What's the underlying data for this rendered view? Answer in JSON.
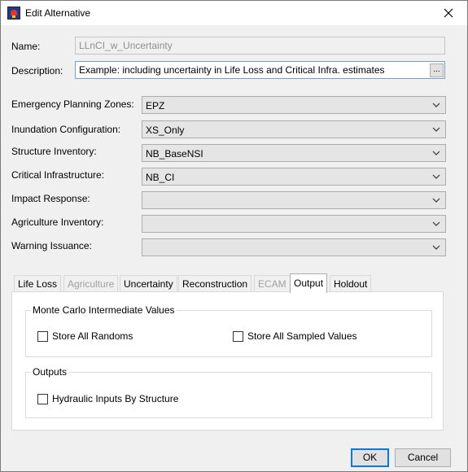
{
  "window": {
    "title": "Edit Alternative",
    "icon": "app-icon",
    "close_icon": "close-icon"
  },
  "name": {
    "label": "Name:",
    "value": "LLnCI_w_Uncertainty"
  },
  "description": {
    "label": "Description:",
    "value": "Example: including uncertainty in Life Loss and Critical Infra. estimates",
    "button_label": "..."
  },
  "fields": [
    {
      "label": "Emergency Planning Zones:",
      "value": "EPZ"
    },
    {
      "label": "Inundation Configuration:",
      "value": "XS_Only"
    },
    {
      "label": "Structure Inventory:",
      "value": "NB_BaseNSI"
    },
    {
      "label": "Critical Infrastructure:",
      "value": "NB_CI"
    },
    {
      "label": "Impact Response:",
      "value": ""
    },
    {
      "label": "Agriculture Inventory:",
      "value": ""
    },
    {
      "label": "Warning Issuance:",
      "value": ""
    }
  ],
  "tabs": [
    {
      "label": "Life Loss",
      "state": "normal"
    },
    {
      "label": "Agriculture",
      "state": "disabled"
    },
    {
      "label": "Uncertainty",
      "state": "normal"
    },
    {
      "label": "Reconstruction",
      "state": "normal"
    },
    {
      "label": "ECAM",
      "state": "disabled"
    },
    {
      "label": "Output",
      "state": "active"
    },
    {
      "label": "Holdout",
      "state": "normal"
    }
  ],
  "output_tab": {
    "monte_carlo": {
      "title": "Monte Carlo Intermediate Values",
      "store_all_randoms": {
        "label": "Store All Randoms",
        "checked": false
      },
      "store_all_sampled": {
        "label": "Store All Sampled Values",
        "checked": false
      }
    },
    "outputs": {
      "title": "Outputs",
      "hydraulic_inputs": {
        "label": "Hydraulic Inputs By Structure",
        "checked": false
      }
    }
  },
  "buttons": {
    "ok": "OK",
    "cancel": "Cancel"
  },
  "colors": {
    "accent": "#0078d7",
    "window_bg": "#f0f0f0",
    "disabled_text": "#8f8f8f"
  }
}
